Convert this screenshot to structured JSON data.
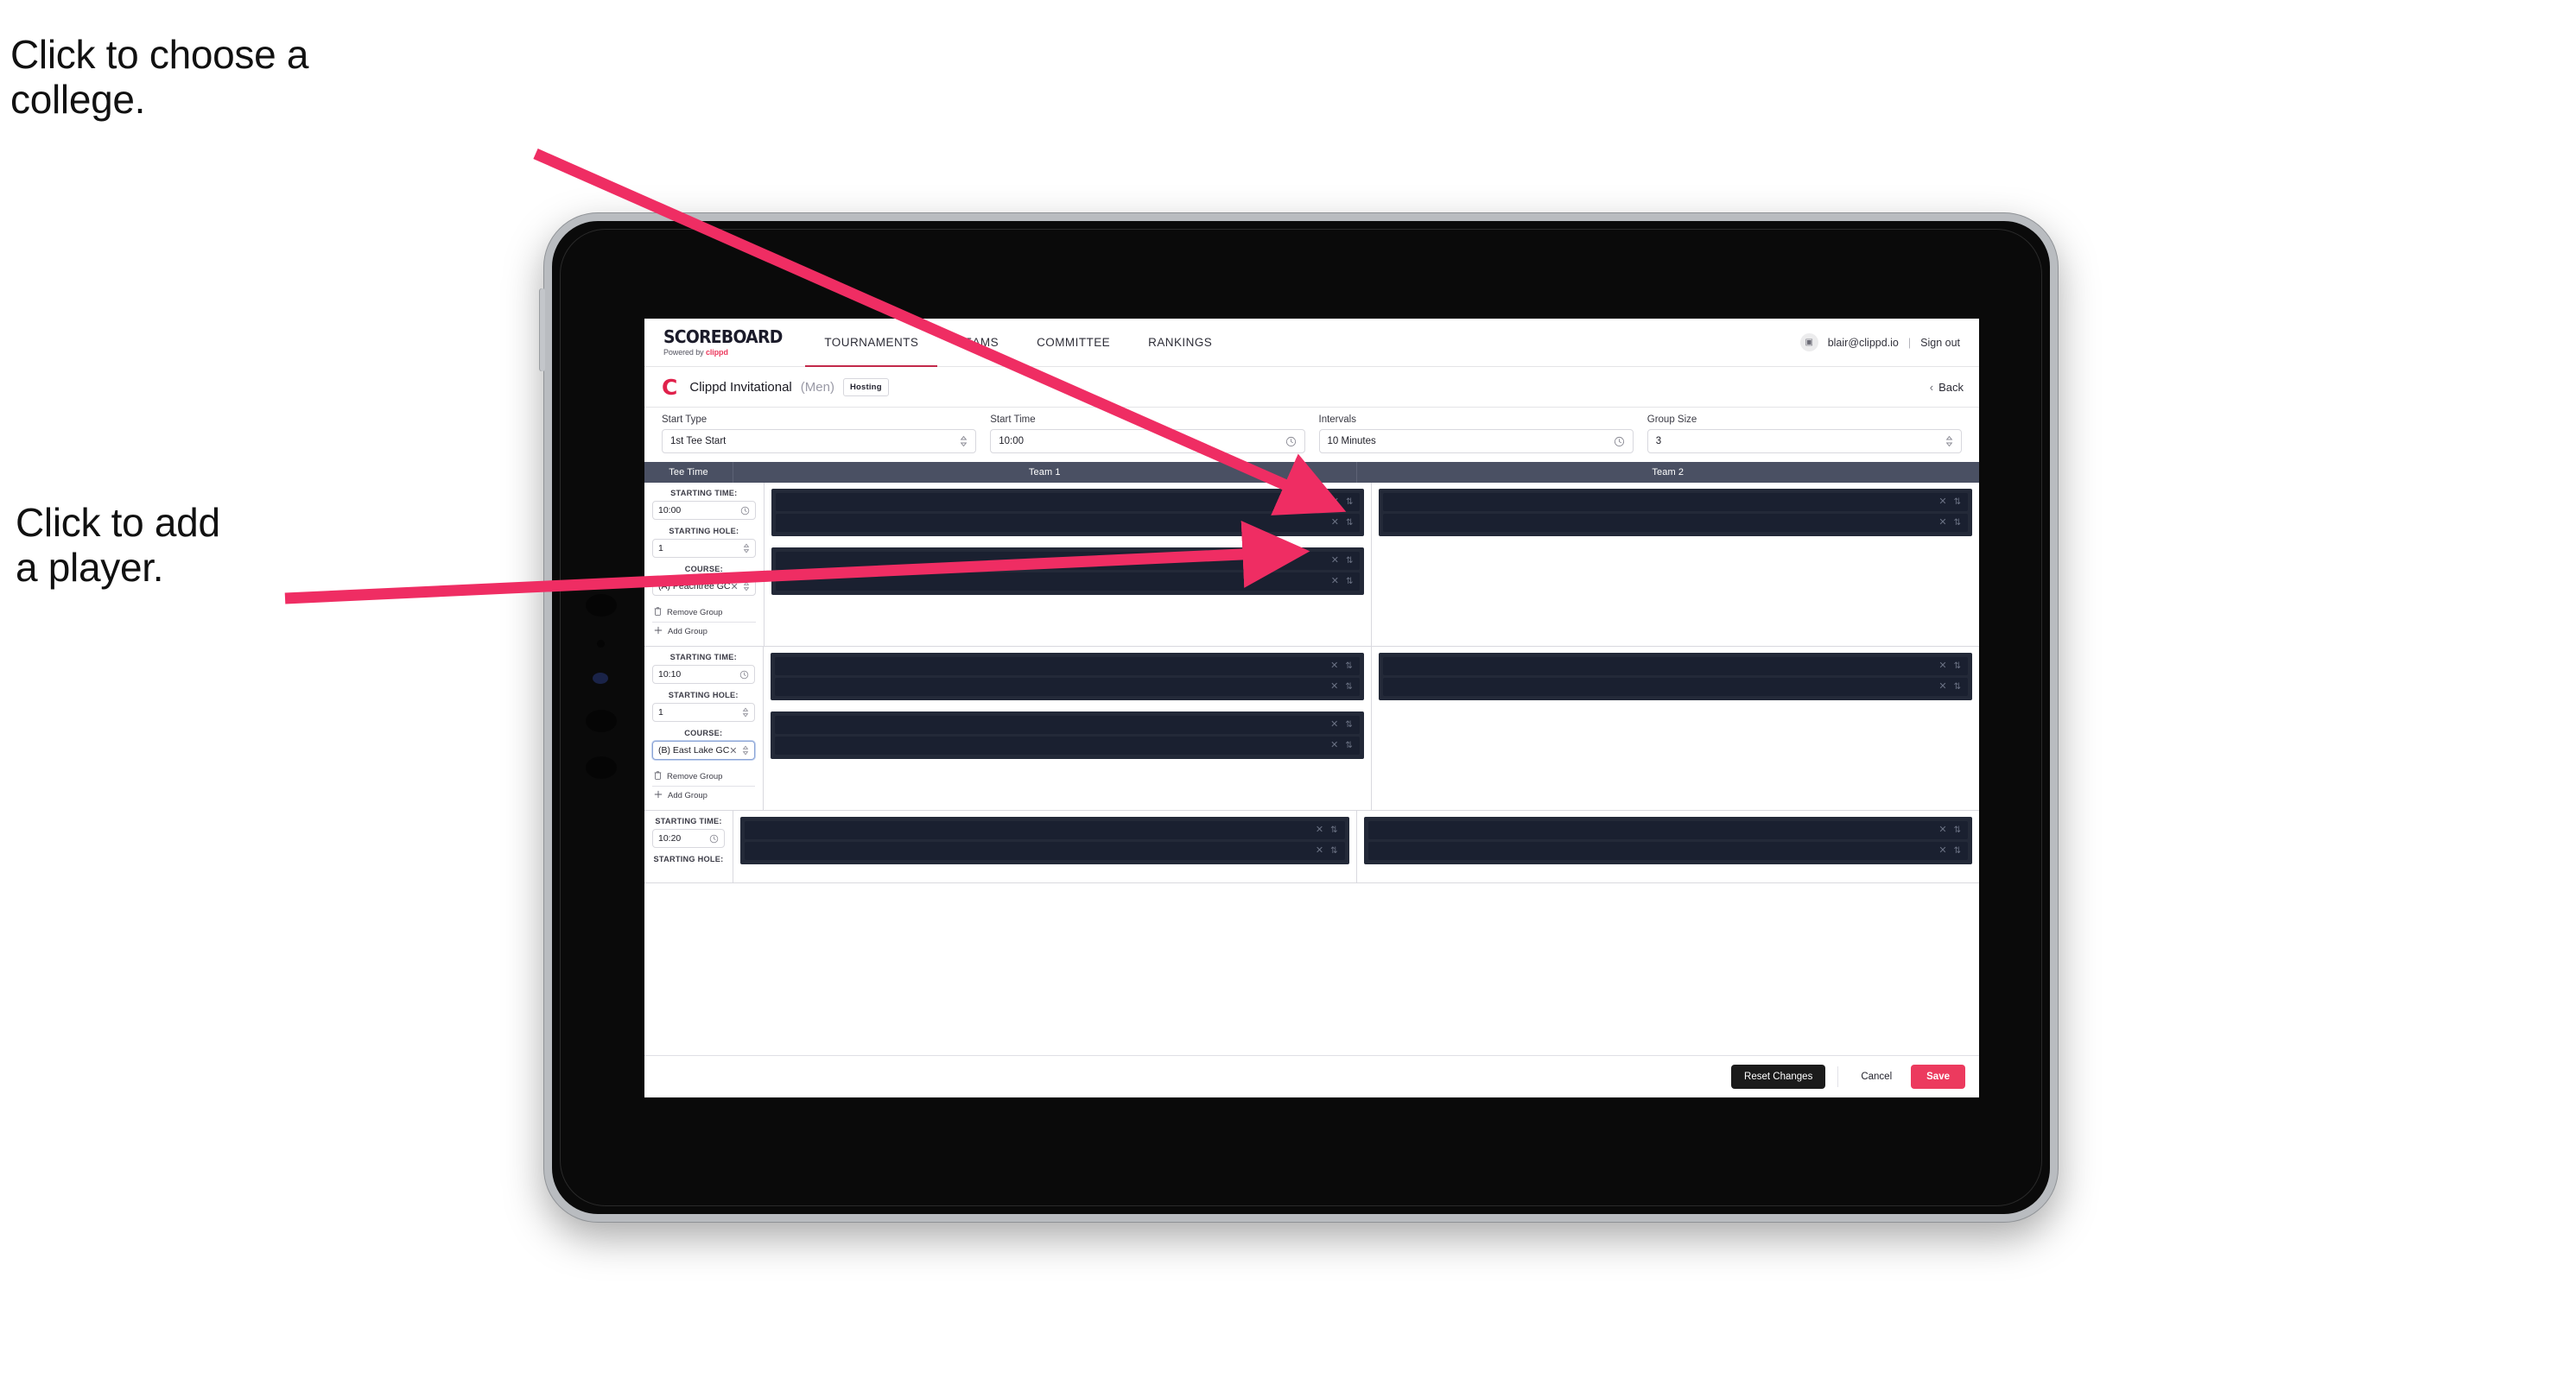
{
  "annotations": [
    {
      "id": "choose-college",
      "text": "Click to choose a\ncollege."
    },
    {
      "id": "add-player",
      "text": "Click to add\na player."
    }
  ],
  "colors": {
    "accent_pink": "#ec3a5e",
    "brand_red": "#e0214b",
    "nav_underline": "#c2294a",
    "table_header_bg": "#4a5063",
    "redaction_outer": "#232938",
    "redaction_inner": "#1a2030",
    "reset_button_bg": "#1b1b1b"
  },
  "topnav": {
    "brand_word": "SCOREBOARD",
    "brand_sub_prefix": "Powered by ",
    "brand_sub_name": "clippd",
    "tabs": [
      {
        "label": "TOURNAMENTS",
        "active": true
      },
      {
        "label": "TEAMS",
        "active": false
      },
      {
        "label": "COMMITTEE",
        "active": false
      },
      {
        "label": "RANKINGS",
        "active": false
      }
    ],
    "avatar_glyph": "▣",
    "user_email": "blair@clippd.io",
    "divider": "|",
    "sign_out": "Sign out"
  },
  "tournament_bar": {
    "logo_letter": "C",
    "name": "Clippd Invitational",
    "gender": "(Men)",
    "badge": "Hosting",
    "back_chevron": "‹",
    "back_label": "Back"
  },
  "filters": [
    {
      "label": "Start Type",
      "value": "1st Tee Start",
      "icon": "stepper-icon"
    },
    {
      "label": "Start Time",
      "value": "10:00",
      "icon": "clock-icon"
    },
    {
      "label": "Intervals",
      "value": "10 Minutes",
      "icon": "clock-icon"
    },
    {
      "label": "Group Size",
      "value": "3",
      "icon": "stepper-icon"
    }
  ],
  "table": {
    "headers": {
      "tee_time": "Tee Time",
      "team1": "Team 1",
      "team2": "Team 2"
    },
    "field_labels": {
      "starting_time": "STARTING TIME:",
      "starting_hole": "STARTING HOLE:",
      "course": "COURSE:"
    },
    "actions": {
      "remove_group": "Remove Group",
      "add_group": "Add Group"
    },
    "rows": [
      {
        "starting_time": "10:00",
        "starting_hole": "1",
        "course": "(A) Peachtree GC",
        "course_focused": false,
        "team1_groups": [
          {
            "slots": 2
          },
          {
            "slots": 2
          }
        ],
        "team2_groups": [
          {
            "slots": 2
          }
        ]
      },
      {
        "starting_time": "10:10",
        "starting_hole": "1",
        "course": "(B) East Lake GC",
        "course_focused": true,
        "team1_groups": [
          {
            "slots": 2
          },
          {
            "slots": 2
          }
        ],
        "team2_groups": [
          {
            "slots": 2
          }
        ]
      },
      {
        "starting_time": "10:20",
        "starting_hole": "",
        "course": "",
        "course_focused": false,
        "partial": true,
        "team1_groups": [
          {
            "slots": 2
          }
        ],
        "team2_groups": [
          {
            "slots": 2
          }
        ]
      }
    ]
  },
  "footer": {
    "reset_label": "Reset Changes",
    "cancel_label": "Cancel",
    "save_label": "Save"
  }
}
